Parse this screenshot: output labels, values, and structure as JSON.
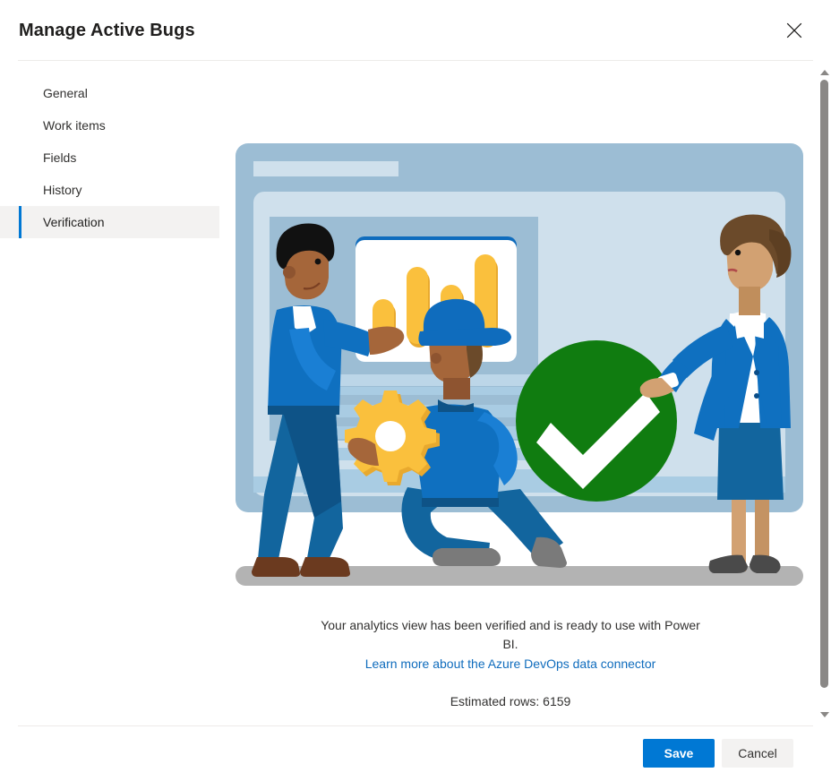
{
  "dialog": {
    "title": "Manage Active Bugs",
    "close_label": "Close",
    "close_icon": "close-icon"
  },
  "nav": {
    "items": [
      {
        "label": "General",
        "selected": false
      },
      {
        "label": "Work items",
        "selected": false
      },
      {
        "label": "Fields",
        "selected": false
      },
      {
        "label": "History",
        "selected": false
      },
      {
        "label": "Verification",
        "selected": true
      }
    ]
  },
  "content": {
    "illustration_name": "analytics-verified-illustration",
    "status_message": "Your analytics view has been verified and is ready to use with Power BI.",
    "link_text": "Learn more about the Azure DevOps data connector",
    "estimated_rows_text": "Estimated rows: 6159"
  },
  "scrollbar": {
    "up_icon": "chevron-up-icon",
    "down_icon": "chevron-down-icon"
  },
  "footer": {
    "save_label": "Save",
    "cancel_label": "Cancel"
  },
  "colors": {
    "accent": "#0078d4",
    "link": "#0f6cbd",
    "success": "#107c10",
    "selected_bg": "#f3f2f1",
    "divider": "#edebe9",
    "text": "#323130",
    "illustration_panel_outer": "#9cbdd4",
    "illustration_panel_inner": "#cfe0ec",
    "illustration_bar": "#fac03d",
    "illustration_floor": "#b3b3b3",
    "illustration_shirt": "#0f70c0",
    "illustration_pants": "#12659e"
  }
}
